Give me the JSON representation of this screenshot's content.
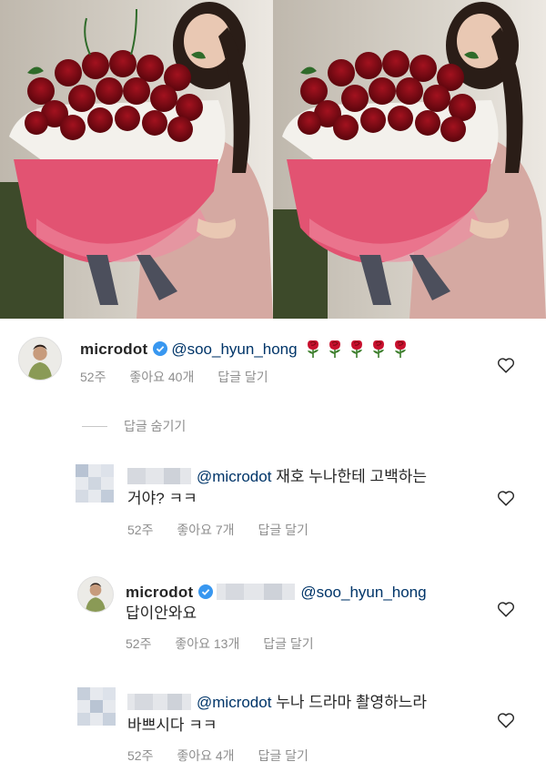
{
  "photos": [
    {
      "alt_icon": "rose-bouquet-photo"
    },
    {
      "alt_icon": "rose-bouquet-photo"
    }
  ],
  "post": {
    "username": "microdot",
    "mention": "@soo_hyun_hong",
    "emoji_count": 5,
    "meta": {
      "time": "52주",
      "likes": "좋아요 40개",
      "reply": "답글 달기"
    }
  },
  "hide_replies_label": "답글 숨기기",
  "replies": [
    {
      "username_hidden": true,
      "mention": "@microdot",
      "text_line1": "재호 누나한테 고백하는",
      "text_line2": "거야? ㅋㅋ",
      "meta": {
        "time": "52주",
        "likes": "좋아요 7개",
        "reply": "답글 달기"
      }
    },
    {
      "username": "microdot",
      "mention": "@soo_hyun_hong",
      "text_line2": "답이안와요",
      "meta": {
        "time": "52주",
        "likes": "좋아요 13개",
        "reply": "답글 달기"
      }
    },
    {
      "username_hidden": true,
      "mention": "@microdot",
      "text_line1": "누나 드라마 촬영하느라",
      "text_line2": "바쁘시다 ㅋㅋ",
      "meta": {
        "time": "52주",
        "likes": "좋아요 4개",
        "reply": "답글 달기"
      }
    }
  ],
  "colors": {
    "username": "#262626",
    "mention": "#003569",
    "meta": "#8e8e8e",
    "verified": "#3897f0",
    "rose": "#c8102e"
  }
}
